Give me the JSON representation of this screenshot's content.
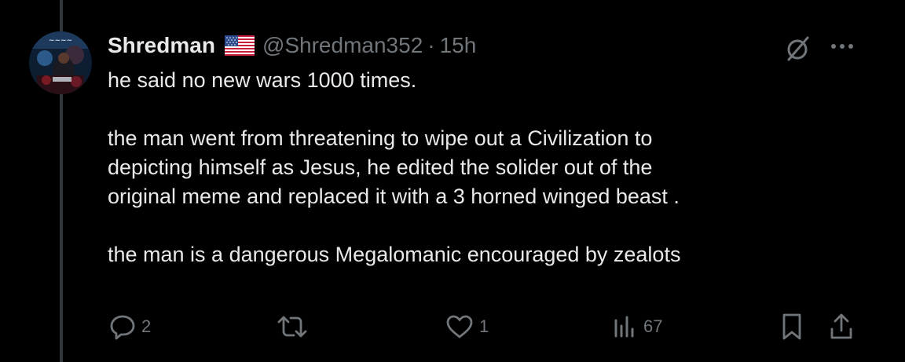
{
  "tweet": {
    "author": {
      "display_name": "Shredman",
      "flag_icon": "us-flag-icon",
      "handle": "@Shredman352",
      "separator": "·",
      "time": "15h"
    },
    "text_lines": [
      "he said no new wars 1000 times.",
      "",
      "the man went from threatening to wipe out a Civilization to",
      "depicting himself as Jesus, he edited the solider out of the",
      "original meme and replaced it with a 3 horned winged beast .",
      "",
      "the man is a dangerous Megalomanic encouraged by zealots"
    ],
    "actions": {
      "replies": "2",
      "reposts": "",
      "likes": "1",
      "views": "67"
    }
  },
  "colors": {
    "background": "#000000",
    "primary_text": "#e7e9ea",
    "secondary_text": "#71767b",
    "thread_line": "#333639"
  }
}
